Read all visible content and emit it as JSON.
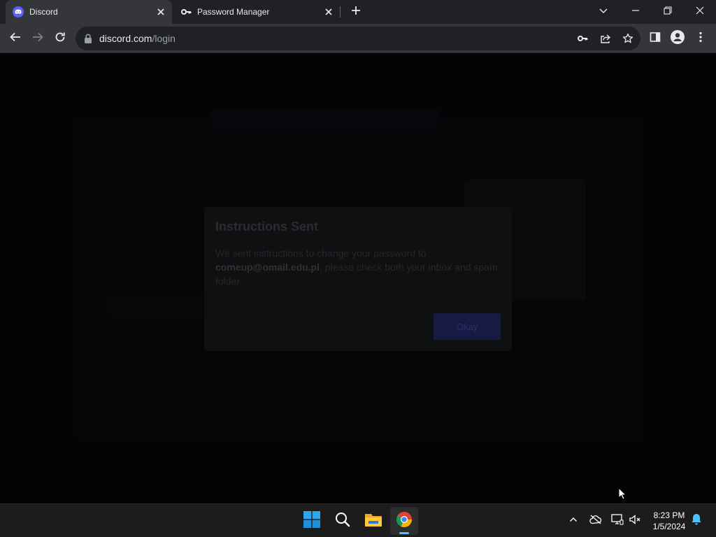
{
  "browser": {
    "tabs": [
      {
        "title": "Discord",
        "active": true
      },
      {
        "title": "Password Manager",
        "active": false
      }
    ],
    "address": {
      "host": "discord.com",
      "path": "/login"
    }
  },
  "page": {
    "dialog": {
      "title": "Instructions Sent",
      "message_before": "We sent instructions to change your password to ",
      "email": "comeup@omail.edu.pl",
      "message_after": ", please check both your inbox and spam folder.",
      "button_label": "Okay"
    }
  },
  "taskbar": {
    "time": "8:23 PM",
    "date": "1/5/2024"
  },
  "colors": {
    "discord_brand": "#5865f2",
    "chrome_accent": "#4cc2ff"
  },
  "icons": [
    "discord-icon",
    "key-icon",
    "close-icon",
    "plus-icon",
    "chevron-down-icon",
    "minimize-icon",
    "restore-icon",
    "back-arrow-icon",
    "forward-arrow-icon",
    "reload-icon",
    "lock-icon",
    "share-icon",
    "star-icon",
    "side-panel-icon",
    "profile-icon",
    "more-vert-icon",
    "windows-start-icon",
    "search-icon",
    "file-explorer-icon",
    "chrome-icon",
    "chevron-up-icon",
    "cloud-offline-icon",
    "network-icon",
    "speaker-muted-icon",
    "bell-icon"
  ]
}
